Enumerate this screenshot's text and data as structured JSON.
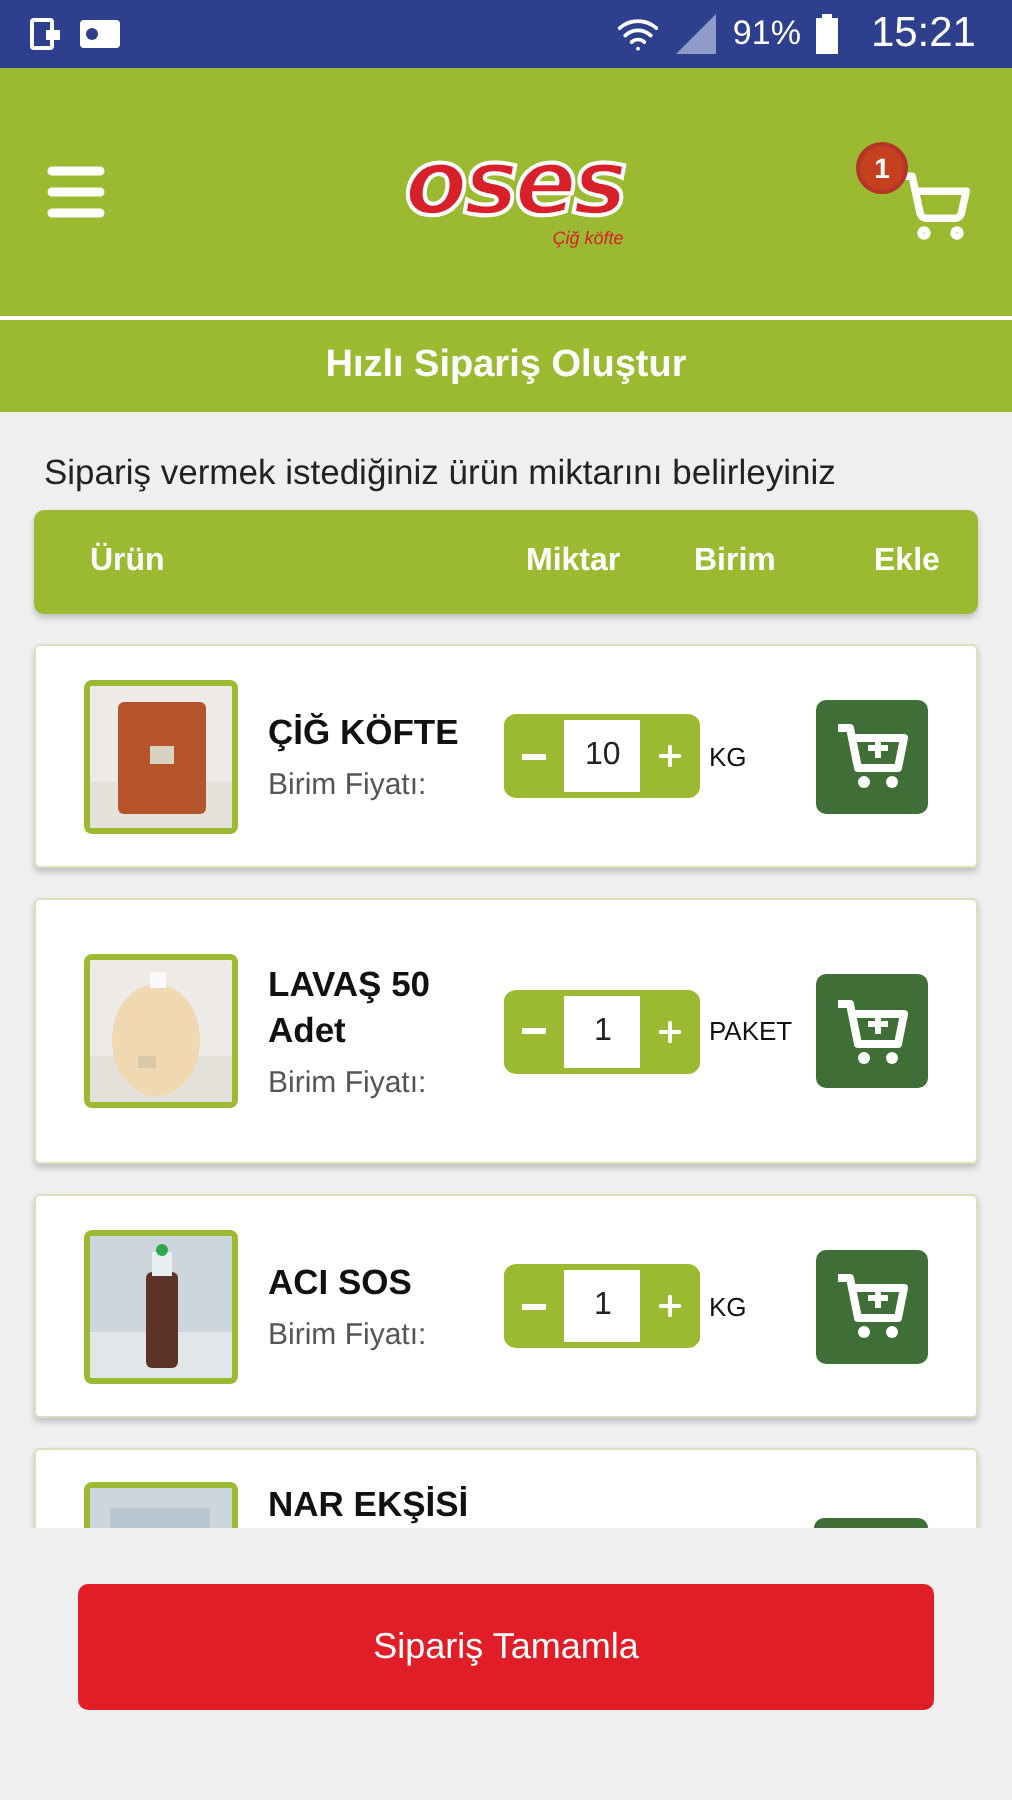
{
  "status_bar": {
    "battery": "91%",
    "time": "15:21"
  },
  "header": {
    "logo": {
      "name": "oses",
      "tagline": "Çiğ köfte"
    },
    "cart_count": "1"
  },
  "title": "Hızlı Sipariş Oluştur",
  "instruction": "Sipariş vermek istediğiniz ürün miktarını belirleyiniz",
  "table": {
    "columns": [
      "Ürün",
      "Miktar",
      "Birim",
      "Ekle"
    ],
    "rows": [
      {
        "name": "ÇİĞ KÖFTE",
        "price_label": "Birim Fiyatı:",
        "quantity": "10",
        "unit": "KG"
      },
      {
        "name": "LAVAŞ 50 Adet",
        "price_label": "Birim Fiyatı:",
        "quantity": "1",
        "unit": "PAKET"
      },
      {
        "name": "ACI SOS",
        "price_label": "Birim Fiyatı:",
        "quantity": "1",
        "unit": "KG"
      },
      {
        "name": "NAR EKŞİSİ"
      }
    ]
  },
  "submit_button": "Sipariş Tamamla"
}
